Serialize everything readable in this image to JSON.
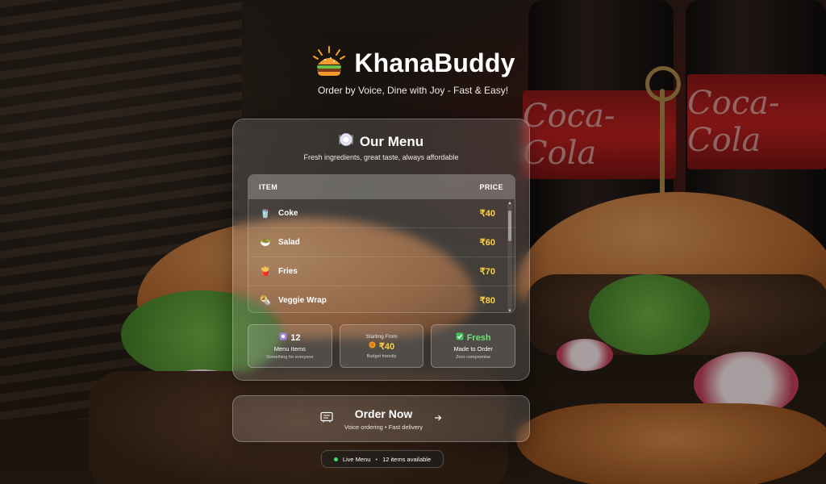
{
  "brand": {
    "logo_icon": "burger-icon",
    "title": "KhanaBuddy",
    "tagline": "Order by Voice, Dine with Joy - Fast & Easy!"
  },
  "menu": {
    "icon": "plate-icon",
    "title": "Our Menu",
    "subtitle": "Fresh ingredients, great taste, always affordable",
    "columns": {
      "item": "ITEM",
      "price": "PRICE"
    },
    "rows": [
      {
        "emoji": "🥤",
        "icon": "drink-icon",
        "name": "Coke",
        "price": "₹40"
      },
      {
        "emoji": "🥗",
        "icon": "salad-icon",
        "name": "Salad",
        "price": "₹60"
      },
      {
        "emoji": "🍟",
        "icon": "fries-icon",
        "name": "Fries",
        "price": "₹70"
      },
      {
        "emoji": "🌯",
        "icon": "wrap-icon",
        "name": "Veggie Wrap",
        "price": "₹80"
      }
    ]
  },
  "stats": [
    {
      "icon": "count-icon",
      "value": "12",
      "label": "Menu Items",
      "note": "Something for everyone"
    },
    {
      "mini": "Starting From",
      "icon": "coin-icon",
      "value": "₹40",
      "note": "Budget friendly"
    },
    {
      "icon": "check-icon",
      "value": "Fresh",
      "label": "Made to Order",
      "note": "Zero compromise"
    }
  ],
  "order": {
    "icon": "menu-board-icon",
    "title": "Order Now",
    "subtitle": "Voice ordering • Fast delivery",
    "arrow_icon": "arrow-right-icon"
  },
  "status": {
    "live": "Live Menu",
    "separator": "•",
    "count": "12 items available"
  },
  "background": {
    "bottle_label": "Coca-Cola"
  },
  "colors": {
    "price": "#ffd23f",
    "fresh": "#6ee27a",
    "live_dot": "#3ddc6b"
  }
}
